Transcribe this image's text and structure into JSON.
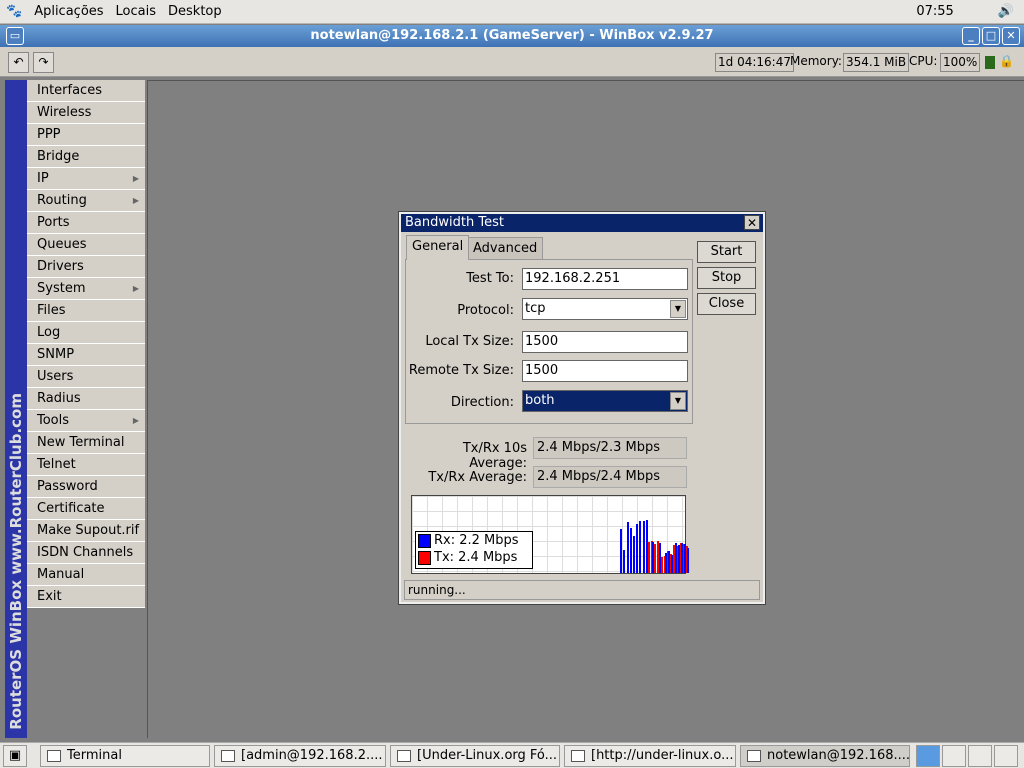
{
  "topbar": {
    "menus": [
      "Aplicações",
      "Locais",
      "Desktop"
    ],
    "clock": "07:55"
  },
  "window": {
    "title": "notewlan@192.168.2.1 (GameServer) - WinBox v2.9.27"
  },
  "status": {
    "uptime": "1d 04:16:47",
    "memory_label": "Memory:",
    "memory": "354.1 MiB",
    "cpu_label": "CPU:",
    "cpu": "100%"
  },
  "sidebar": {
    "brand": "RouterOS WinBox   www.RouterClub.com",
    "items": [
      {
        "label": "Interfaces"
      },
      {
        "label": "Wireless"
      },
      {
        "label": "PPP"
      },
      {
        "label": "Bridge"
      },
      {
        "label": "IP",
        "sub": true
      },
      {
        "label": "Routing",
        "sub": true
      },
      {
        "label": "Ports"
      },
      {
        "label": "Queues"
      },
      {
        "label": "Drivers"
      },
      {
        "label": "System",
        "sub": true
      },
      {
        "label": "Files"
      },
      {
        "label": "Log"
      },
      {
        "label": "SNMP"
      },
      {
        "label": "Users"
      },
      {
        "label": "Radius"
      },
      {
        "label": "Tools",
        "sub": true
      },
      {
        "label": "New Terminal"
      },
      {
        "label": "Telnet"
      },
      {
        "label": "Password"
      },
      {
        "label": "Certificate"
      },
      {
        "label": "Make Supout.rif"
      },
      {
        "label": "ISDN Channels"
      },
      {
        "label": "Manual"
      },
      {
        "label": "Exit"
      }
    ]
  },
  "dialog": {
    "title": "Bandwidth Test",
    "tabs": [
      "General",
      "Advanced"
    ],
    "fields": {
      "test_to_label": "Test To:",
      "test_to": "192.168.2.251",
      "protocol_label": "Protocol:",
      "protocol": "tcp",
      "local_tx_label": "Local Tx Size:",
      "local_tx": "1500",
      "remote_tx_label": "Remote Tx Size:",
      "remote_tx": "1500",
      "direction_label": "Direction:",
      "direction": "both"
    },
    "buttons": {
      "start": "Start",
      "stop": "Stop",
      "close": "Close"
    },
    "avg10_label": "Tx/Rx 10s Average:",
    "avg10": "2.4 Mbps/2.3 Mbps",
    "avg_label": "Tx/Rx Average:",
    "avg": "2.4 Mbps/2.4 Mbps",
    "legend": {
      "rx": "Rx: 2.2 Mbps",
      "tx": "Tx: 2.4 Mbps"
    },
    "status": "running..."
  },
  "chart_data": {
    "type": "bar",
    "series": [
      {
        "name": "Rx: 2.2 Mbps",
        "color": "#0000ff",
        "values": [
          0.44,
          0.23,
          0.51,
          0.45,
          0.37,
          0.49,
          0.52,
          0.52,
          0.53,
          0,
          0.31,
          0,
          0.3,
          0,
          0.2,
          0.22,
          0.18,
          0.3,
          0.28,
          0.3,
          0.29,
          0.25
        ]
      },
      {
        "name": "Tx: 2.4 Mbps",
        "color": "#ff0000",
        "values": [
          0,
          0,
          0,
          0,
          0,
          0,
          0,
          0,
          0,
          0.31,
          0.32,
          0.29,
          0.32,
          0.16,
          0.17,
          0.22,
          0.19,
          0.28,
          0.27,
          0.3,
          0.29,
          0.27
        ]
      }
    ]
  },
  "taskbar": {
    "tasks": [
      "Terminal",
      "[admin@192.168.2....",
      "[Under-Linux.org Fó...",
      "[http://under-linux.o...",
      "notewlan@192.168...."
    ]
  }
}
